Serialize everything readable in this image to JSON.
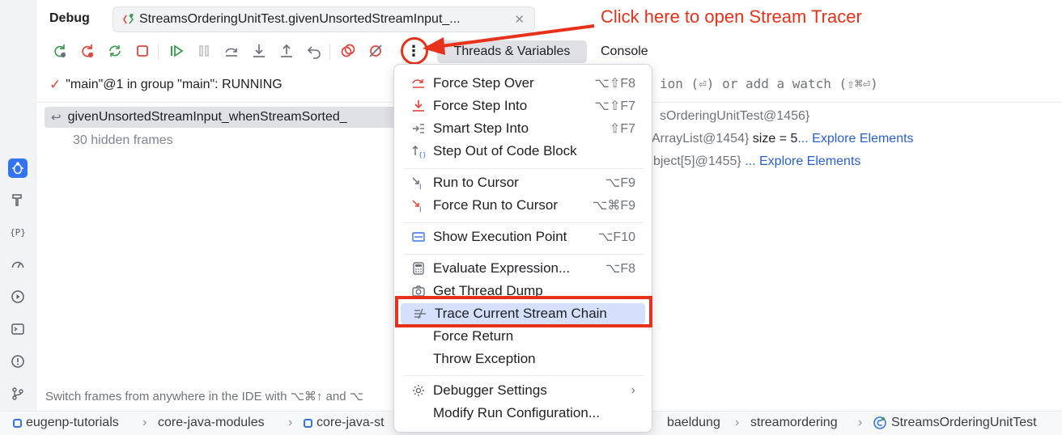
{
  "annotation": {
    "text": "Click here to open Stream Tracer",
    "color": "#e8311a"
  },
  "panel": {
    "title": "Debug",
    "tab_label": "StreamsOrderingUnitTest.givenUnsortedStreamInput_...",
    "threads_variables": "Threads & Variables",
    "console": "Console"
  },
  "thread": {
    "status": "\"main\"@1 in group \"main\": RUNNING"
  },
  "frames": {
    "current": "givenUnsortedStreamInput_whenStreamSorted_",
    "hidden": "30 hidden frames"
  },
  "variables": {
    "watch_hint": "ion (⏎) or add a watch (⇧⌘⏎)",
    "line1": "sOrderingUnitTest@1456}",
    "line2_prefix": "ArrayList@1454}",
    "line2_size": "size = 5",
    "line2_link": "... Explore Elements",
    "line3_prefix": "bject[5]@1455}",
    "line3_link": "... Explore Elements"
  },
  "hint": "Switch frames from anywhere in the IDE with ⌥⌘↑ and ⌥",
  "menu": {
    "items": [
      {
        "label": "Force Step Over",
        "shortcut": "⌥⇧F8"
      },
      {
        "label": "Force Step Into",
        "shortcut": "⌥⇧F7"
      },
      {
        "label": "Smart Step Into",
        "shortcut": "⇧F7"
      },
      {
        "label": "Step Out of Code Block",
        "shortcut": ""
      },
      {
        "label": "Run to Cursor",
        "shortcut": "⌥F9"
      },
      {
        "label": "Force Run to Cursor",
        "shortcut": "⌥⌘F9"
      },
      {
        "label": "Show Execution Point",
        "shortcut": "⌥F10"
      },
      {
        "label": "Evaluate Expression...",
        "shortcut": "⌥F8"
      },
      {
        "label": "Get Thread Dump",
        "shortcut": ""
      },
      {
        "label": "Trace Current Stream Chain",
        "shortcut": ""
      },
      {
        "label": "Force Return",
        "shortcut": ""
      },
      {
        "label": "Throw Exception",
        "shortcut": ""
      },
      {
        "label": "Debugger Settings",
        "shortcut": ""
      },
      {
        "label": "Modify Run Configuration...",
        "shortcut": ""
      }
    ]
  },
  "breadcrumbs": [
    "eugenp-tutorials",
    "core-java-modules",
    "core-java-st",
    "baeldung",
    "streamordering",
    "StreamsOrderingUnitTest"
  ],
  "colors": {
    "accent": "#3574f0",
    "annotation_red": "#e8311a",
    "highlight": "#d5e1fc",
    "link": "#2a5fd0"
  }
}
